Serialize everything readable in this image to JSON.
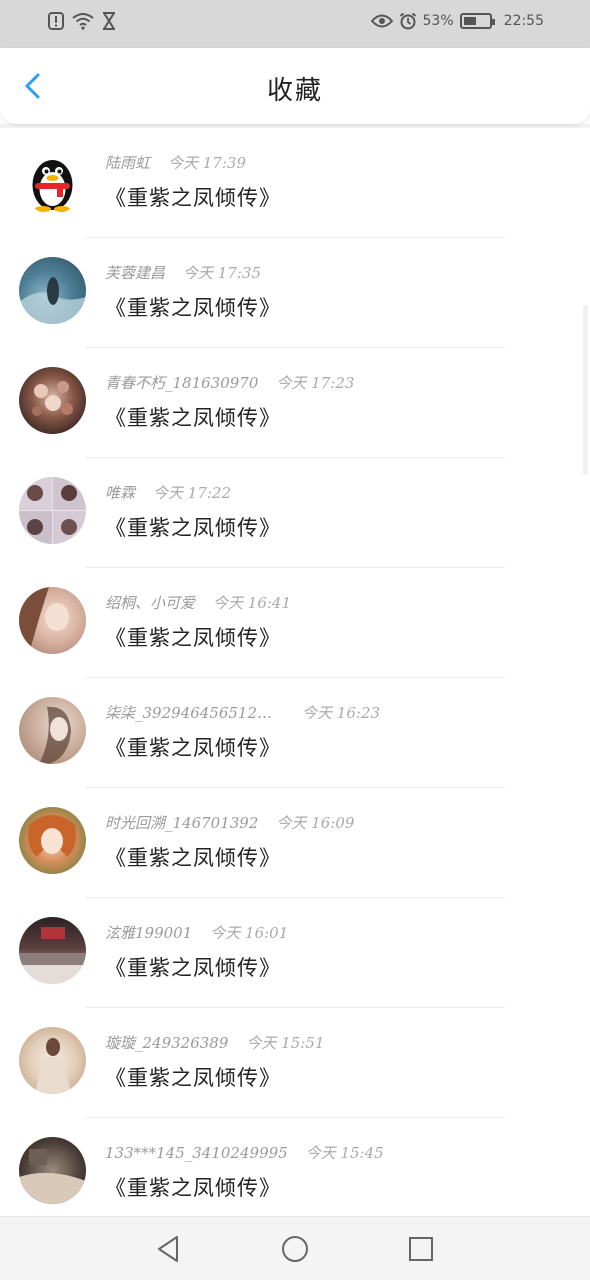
{
  "status_bar": {
    "left_icons": [
      "alert-icon",
      "wifi-icon",
      "hourglass-icon"
    ],
    "battery_percent": "53%",
    "battery_level": 0.53,
    "time": "22:55",
    "right_icons": [
      "eye-icon",
      "alarm-icon",
      "battery-icon"
    ]
  },
  "header": {
    "title": "收藏",
    "back_icon": "chevron-left-icon"
  },
  "list": {
    "items": [
      {
        "name": "陆雨虹",
        "time": "今天  17:39",
        "title": "《重紫之凤倾传》",
        "avatar": "penguin-avatar"
      },
      {
        "name": "芙蓉建昌",
        "time": "今天  17:35",
        "title": "《重紫之凤倾传》",
        "avatar": "landscape-avatar"
      },
      {
        "name": "青春不朽_181630970",
        "time": "今天  17:23",
        "title": "《重紫之凤倾传》",
        "avatar": "flowers-avatar"
      },
      {
        "name": "唯霖",
        "time": "今天  17:22",
        "title": "《重紫之凤倾传》",
        "avatar": "collage-avatar"
      },
      {
        "name": "绍桐、小可爱",
        "time": "今天  16:41",
        "title": "《重紫之凤倾传》",
        "avatar": "girl-avatar"
      },
      {
        "name": "柒柒_392946456512…",
        "time": "今天  16:23",
        "title": "《重紫之凤倾传》",
        "avatar": "portrait-avatar"
      },
      {
        "name": "时光回溯_146701392",
        "time": "今天  16:09",
        "title": "《重紫之凤倾传》",
        "avatar": "girl-orange-avatar"
      },
      {
        "name": "泫雅199001",
        "time": "今天  16:01",
        "title": "《重紫之凤倾传》",
        "avatar": "restaurant-avatar"
      },
      {
        "name": "璇璇_249326389",
        "time": "今天  15:51",
        "title": "《重紫之凤倾传》",
        "avatar": "woman-coat-avatar"
      },
      {
        "name": "133***145_3410249995",
        "time": "今天  15:45",
        "title": "《重紫之凤倾传》",
        "avatar": "room-avatar"
      }
    ]
  },
  "nav_bar": {
    "back_icon": "triangle-back-icon",
    "home_icon": "circle-home-icon",
    "recent_icon": "square-recent-icon"
  },
  "colors": {
    "accent": "#2a9df4",
    "status_bar_bg": "#d8d8d8",
    "meta_text": "#9a9a9a",
    "title_text": "#222222"
  }
}
